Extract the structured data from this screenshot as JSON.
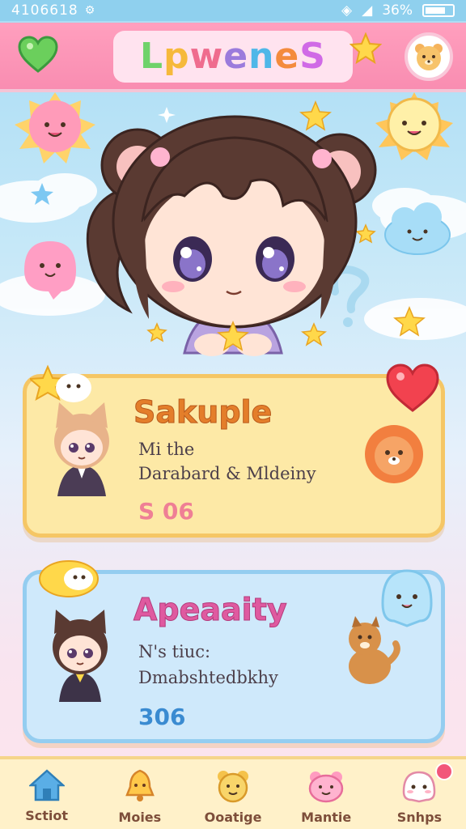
{
  "status_bar": {
    "time": "4106618",
    "battery": "36%"
  },
  "header": {
    "title_letters": [
      "L",
      "p",
      "w",
      "e",
      "n",
      "e",
      "S"
    ],
    "title": "Lpwenes"
  },
  "cards": [
    {
      "title": "Sakuple",
      "line1": "Mi the",
      "line2": "Darabard & Mldeiny",
      "count": "S 06"
    },
    {
      "title": "Apeaaity",
      "line1": "N's tiuc:",
      "line2": "Dmabshtedbkhy",
      "count": "306"
    }
  ],
  "nav": [
    {
      "label": "Sctiot",
      "icon": "home-icon"
    },
    {
      "label": "Moies",
      "icon": "bell-icon"
    },
    {
      "label": "Ooatige",
      "icon": "bear-face-icon"
    },
    {
      "label": "Mantie",
      "icon": "pink-bear-icon"
    },
    {
      "label": "Snhps",
      "icon": "ghost-icon"
    }
  ],
  "colors": {
    "header_bg": "#f98db1",
    "card1_bg": "#fde9a6",
    "card2_bg": "#cfe9fb",
    "nav_bg": "#fff1c9"
  }
}
